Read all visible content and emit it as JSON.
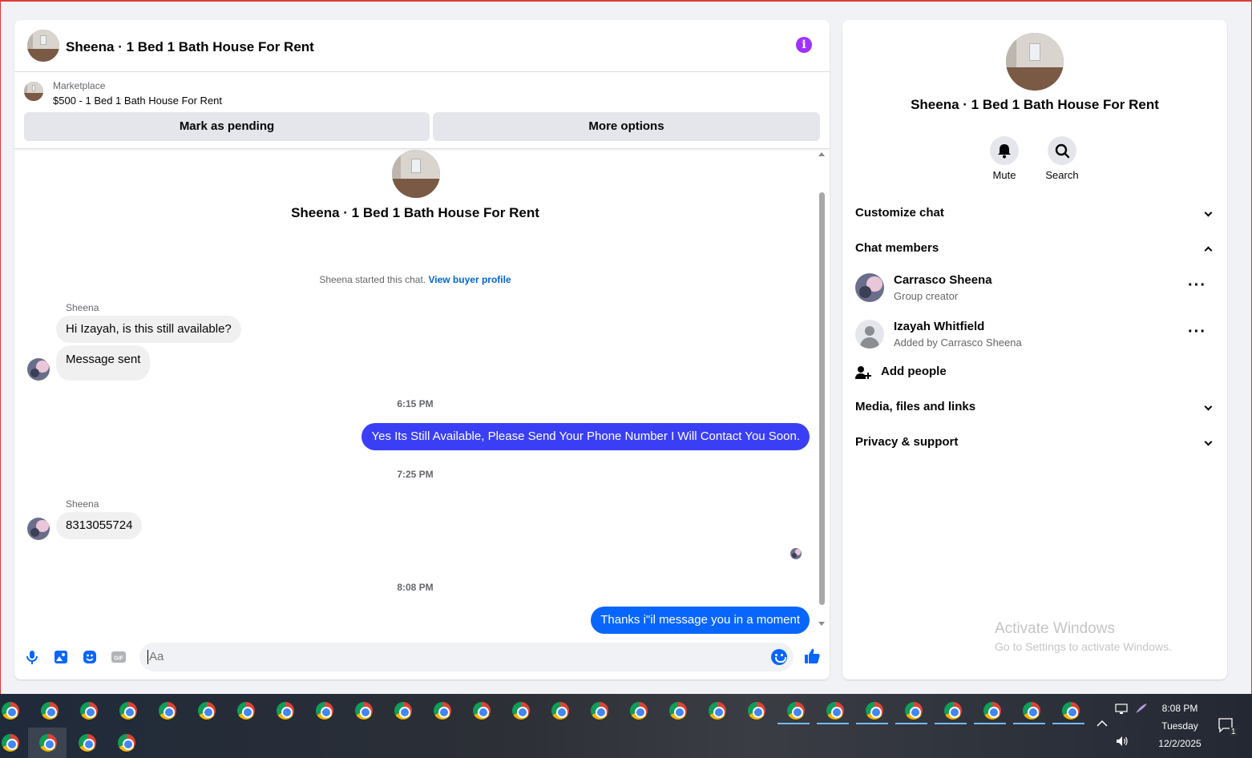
{
  "header": {
    "title": "Sheena · 1 Bed 1 Bath House For Rent"
  },
  "marketplace": {
    "label": "Marketplace",
    "item": "$500 - 1 Bed 1 Bath House For Rent",
    "pending_label": "Mark as pending",
    "more_label": "More options"
  },
  "conversation": {
    "title": "Sheena · 1 Bed 1 Bath House For Rent",
    "started_text": "Sheena started this chat.",
    "buyer_link": "View buyer profile",
    "messages": [
      {
        "sender": "Sheena",
        "text": "Hi Izayah, is this still available?"
      },
      {
        "text": "Message sent"
      },
      {
        "time": "6:15 PM"
      },
      {
        "text": "Yes Its Still Available, Please Send Your Phone Number I Will Contact You Soon."
      },
      {
        "time": "7:25 PM"
      },
      {
        "sender": "Sheena",
        "text": "8313055724"
      },
      {
        "time": "8:08 PM"
      },
      {
        "text": "Thanks i\"il message you in a moment"
      }
    ]
  },
  "composer": {
    "placeholder": "Aa"
  },
  "info_panel": {
    "title": "Sheena · 1 Bed 1 Bath House For Rent",
    "mute_label": "Mute",
    "search_label": "Search",
    "customize_label": "Customize chat",
    "members_label": "Chat members",
    "members": [
      {
        "name": "Carrasco Sheena",
        "role": "Group creator"
      },
      {
        "name": "Izayah Whitfield",
        "role": "Added by Carrasco Sheena"
      }
    ],
    "add_people_label": "Add people",
    "media_label": "Media, files and links",
    "privacy_label": "Privacy & support",
    "activate_title": "Activate Windows",
    "activate_sub": "Go to Settings to activate Windows."
  },
  "taskbar": {
    "time": "8:08 PM",
    "day": "Tuesday",
    "date": "12/2/2025",
    "notification_count": "1"
  },
  "colors": {
    "outgoing_bubble": "#3a3ff5",
    "outgoing_bubble_last": "#0866ff",
    "info_icon": "#a033ff",
    "accent": "#0866ff"
  }
}
